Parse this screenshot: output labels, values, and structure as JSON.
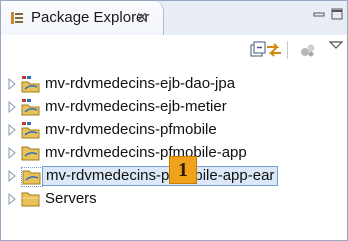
{
  "view": {
    "tab_title": "Package Explorer",
    "tab_close_glyph": "✕",
    "tab_icon": "package-explorer-icon"
  },
  "toolbar": {
    "buttons": [
      "collapse-all-icon",
      "link-with-editor-icon",
      "focus-on-active-task-icon",
      "view-menu-icon"
    ]
  },
  "tree": {
    "items": [
      {
        "label": "mv-rdvmedecins-ejb-dao-jpa",
        "icon": "maven-project-icon"
      },
      {
        "label": "mv-rdvmedecins-ejb-metier",
        "icon": "maven-project-icon"
      },
      {
        "label": "mv-rdvmedecins-pfmobile",
        "icon": "maven-project-icon"
      },
      {
        "label": "mv-rdvmedecins-pfmobile-app",
        "icon": "folder-project-icon"
      },
      {
        "label": "mv-rdvmedecins-pfmobile-app-ear",
        "icon": "folder-project-icon",
        "selected": true
      },
      {
        "label": "Servers",
        "icon": "folder-icon"
      }
    ]
  },
  "annotation": {
    "badge_number": "1"
  },
  "colors": {
    "selection_border": "#7a9cd3",
    "selection_fill": "#dce8f8",
    "badge": "#f0a21a"
  }
}
